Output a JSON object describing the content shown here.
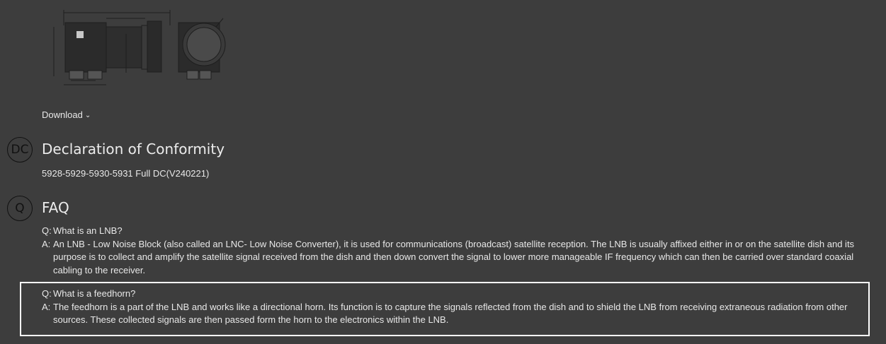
{
  "download": {
    "label": "Download",
    "chevron": "chevron-down-icon"
  },
  "sections": {
    "dc": {
      "badge": "DC",
      "title": "Declaration of Conformity",
      "link": "5928-5929-5930-5931 Full DC(V240221)"
    },
    "faq": {
      "badge": "Q",
      "title": "FAQ",
      "items": [
        {
          "q_prefix": "Q:",
          "question": "What is an LNB?",
          "a_prefix": "A:",
          "answer": "An LNB - Low Noise Block (also called an LNC- Low Noise Converter), it is used for communications (broadcast) satellite reception. The LNB is usually affixed either in or on the satellite dish and its purpose is to collect and amplify the satellite signal received from the dish and then down convert the signal to lower more manageable IF frequency which can then be carried over standard coaxial cabling to the receiver."
        },
        {
          "q_prefix": "Q:",
          "question": "What is a feedhorn?",
          "a_prefix": "A:",
          "answer": "The feedhorn is a part of the LNB and works like a directional horn. Its function is to capture the signals reflected from the dish and to shield the LNB from receiving extraneous radiation from other sources. These collected signals are then passed form the horn to the electronics within the LNB."
        }
      ]
    }
  },
  "colors": {
    "background": "#3d3d3d",
    "text": "#e8e8e8",
    "highlight_border": "#ffffff",
    "badge_border": "#111111"
  }
}
